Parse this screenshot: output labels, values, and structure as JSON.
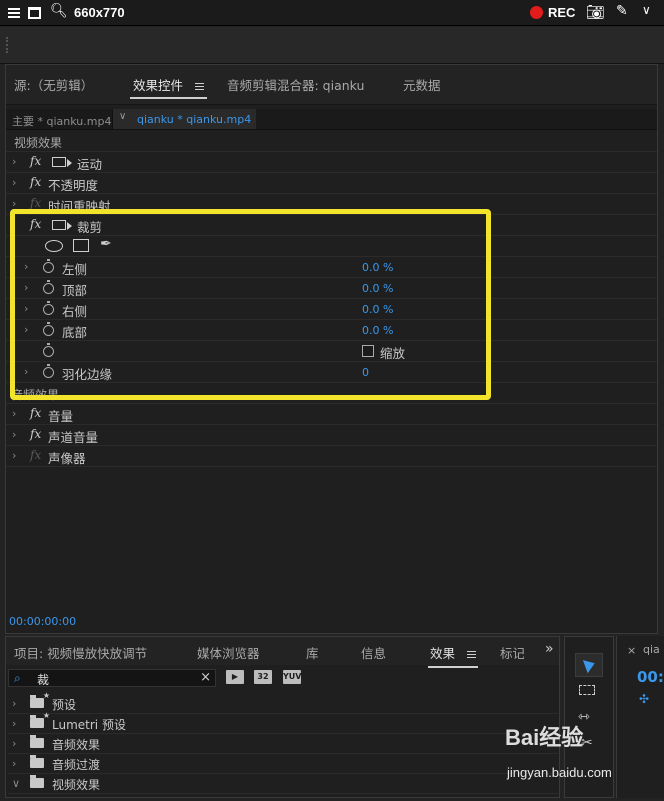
{
  "recorder": {
    "resolution": "660x770",
    "rec_label": "REC"
  },
  "tabs": [
    {
      "label": "源:（无剪辑）"
    },
    {
      "label": "效果控件",
      "active": true
    },
    {
      "label": "音频剪辑混合器: qianku"
    },
    {
      "label": "元数据"
    }
  ],
  "clip": {
    "master": "主要 * qianku.mp4",
    "sequence": "qianku * qianku.mp4"
  },
  "effects": {
    "video_section": "视频效果",
    "motion": "运动",
    "opacity": "不透明度",
    "time_remap": "时间重映射",
    "crop": {
      "name": "裁剪",
      "params": [
        {
          "label": "左侧",
          "value": "0.0 %"
        },
        {
          "label": "顶部",
          "value": "0.0 %"
        },
        {
          "label": "右侧",
          "value": "0.0 %"
        },
        {
          "label": "底部",
          "value": "0.0 %"
        }
      ],
      "zoom_label": "缩放",
      "feather_label": "羽化边缘",
      "feather_value": "0"
    },
    "audio_section": "音频效果",
    "volume": "音量",
    "channel_volume": "声道音量",
    "panner": "声像器"
  },
  "timecode": "00:00:00:00",
  "bottom": {
    "tabs": [
      {
        "label": "项目: 视频慢放快放调节"
      },
      {
        "label": "媒体浏览器"
      },
      {
        "label": "库"
      },
      {
        "label": "信息"
      },
      {
        "label": "效果",
        "active": true
      },
      {
        "label": "标记"
      }
    ],
    "search_value": "裁",
    "tool_icons": [
      "32",
      "YUV"
    ],
    "tree": [
      {
        "label": "预设",
        "expanded": false
      },
      {
        "label": "Lumetri 预设",
        "expanded": false
      },
      {
        "label": "音频效果",
        "expanded": false
      },
      {
        "label": "音频过渡",
        "expanded": false
      },
      {
        "label": "视频效果",
        "expanded": true
      }
    ]
  },
  "timeline": {
    "name": "qia",
    "timecode": "00:"
  },
  "watermark": {
    "brand": "Bai经验",
    "url": "jingyan.baidu.com"
  },
  "colors": {
    "accent": "#3a97ea",
    "highlight": "#f1e42a",
    "rec": "#e21b1b"
  }
}
